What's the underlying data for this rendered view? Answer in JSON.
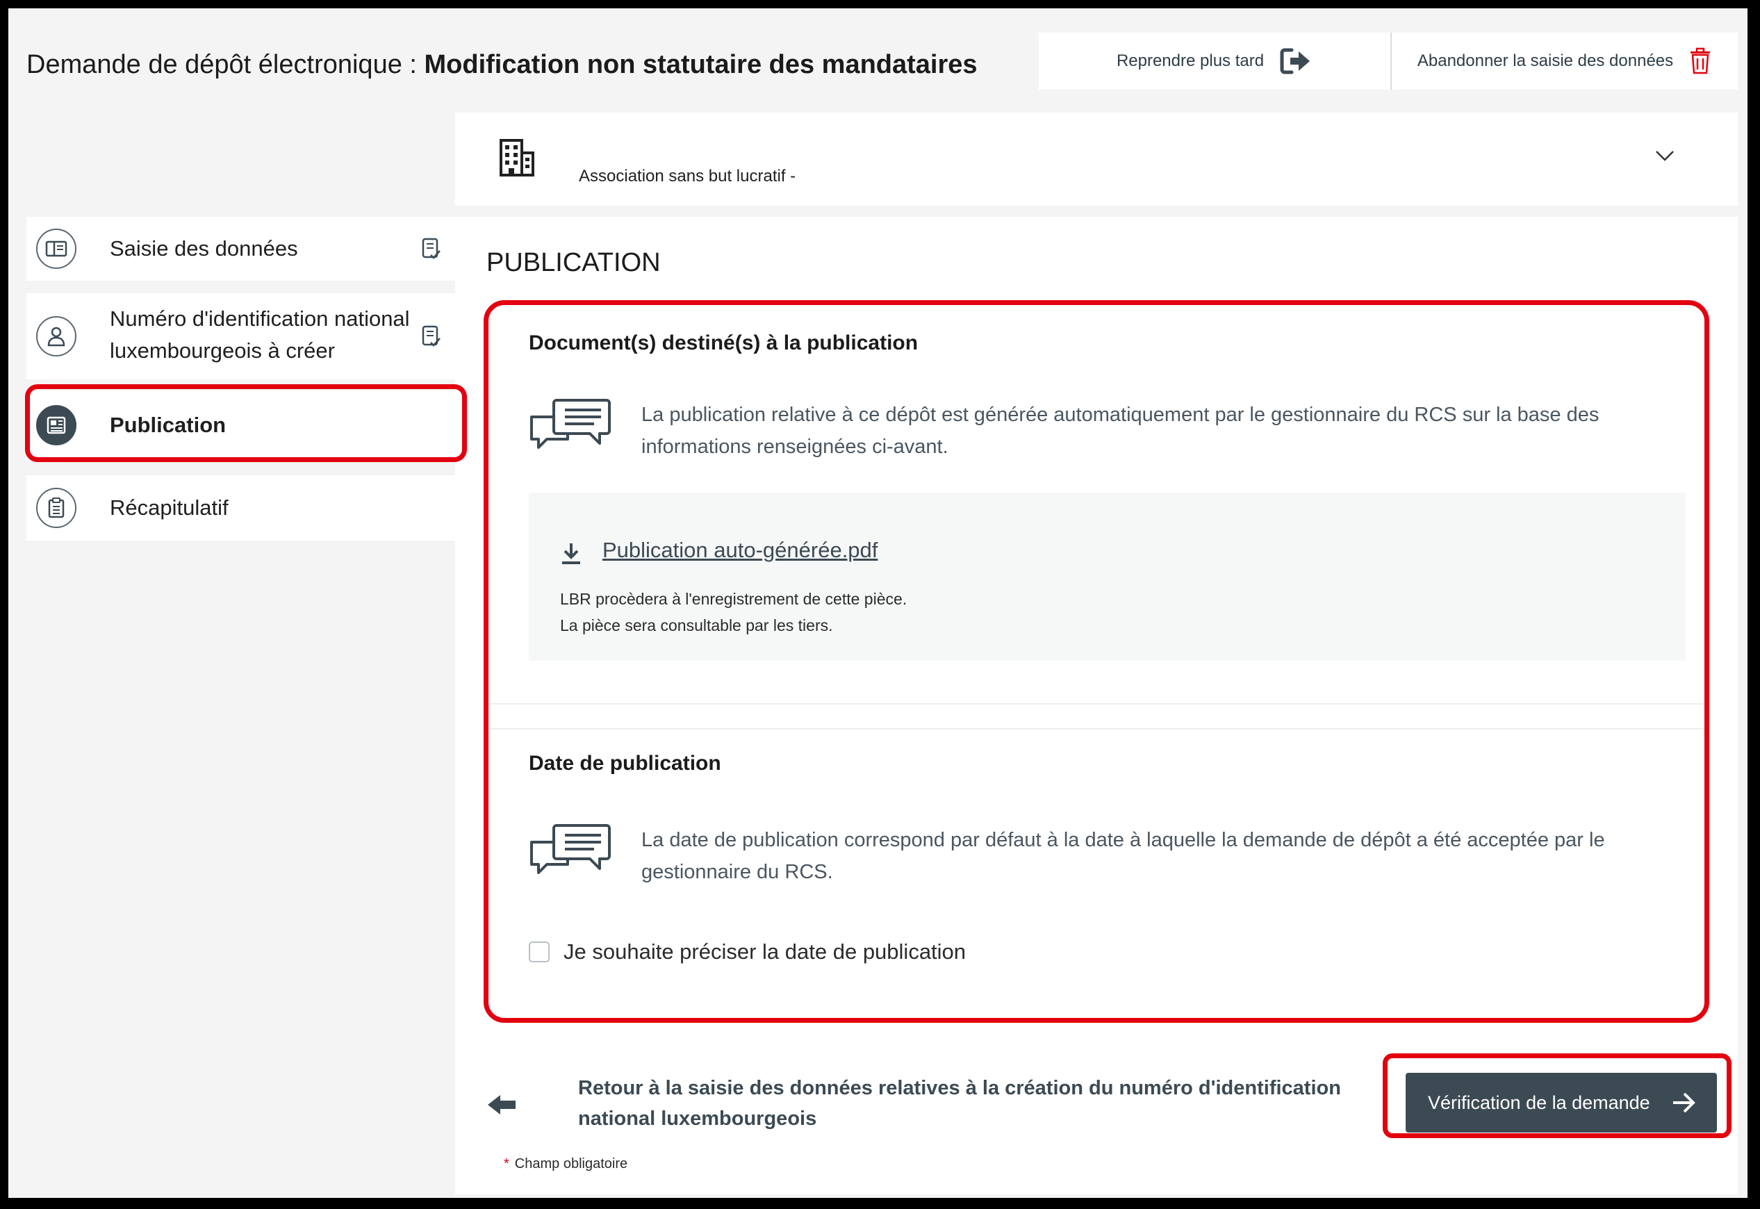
{
  "header": {
    "title_prefix": "Demande de dépôt électronique : ",
    "title_strong": "Modification non statutaire des mandataires",
    "resume_label": "Reprendre plus tard",
    "abandon_label": "Abandonner la saisie des données"
  },
  "entity": {
    "name": "Association sans but lucratif -"
  },
  "sidebar": {
    "items": [
      {
        "label": "Saisie des données",
        "icon": "document-icon"
      },
      {
        "label_line1": "Numéro d'identification national",
        "label_line2": "luxembourgeois à créer",
        "icon": "person-icon"
      },
      {
        "label": "Publication",
        "icon": "newspaper-icon",
        "active": true
      },
      {
        "label": "Récapitulatif",
        "icon": "clipboard-icon"
      }
    ]
  },
  "main": {
    "page_title": "PUBLICATION",
    "docs_section": {
      "title": "Document(s) destiné(s) à la publication",
      "info_line1": "La publication relative à ce dépôt est générée automatiquement par le gestionnaire du RCS sur la base des",
      "info_line2": "informations renseignées ci-avant.",
      "file_link": "Publication auto-générée.pdf",
      "note_line1": "LBR procèdera à l'enregistrement de cette pièce.",
      "note_line2": "La pièce sera consultable par les tiers."
    },
    "date_section": {
      "title": "Date de publication",
      "info_line1": "La date de publication correspond par défaut à la date à laquelle la demande de dépôt a été acceptée par le",
      "info_line2": "gestionnaire du RCS.",
      "checkbox_label": "Je souhaite préciser la date de publication",
      "checkbox_checked": false
    },
    "back_line1": "Retour à la saisie des données relatives à la création du numéro d'identification",
    "back_line2": "national luxembourgeois",
    "next_button": "Vérification de la demande",
    "required_note": "Champ obligatoire",
    "required_marker": "*"
  },
  "colors": {
    "accent": "#3c4a54",
    "highlight": "#e3000f",
    "trash": "#e3000f",
    "background": "#f3f4f3"
  }
}
